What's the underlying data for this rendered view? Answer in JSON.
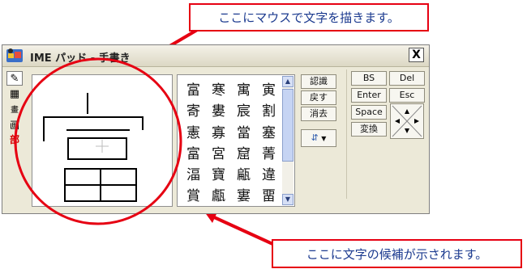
{
  "callouts": {
    "top": "ここにマウスで文字を描きます。",
    "bottom": "ここに文字の候補が示されます。"
  },
  "window": {
    "title": "IME パッド - 手書き",
    "close_label": "X"
  },
  "tools": [
    {
      "icon": "pen-icon",
      "glyph": "✎"
    },
    {
      "icon": "grid-icon",
      "glyph": "▦"
    },
    {
      "icon": "stroke-count-icon",
      "glyph": "画"
    },
    {
      "icon": "radical-icon",
      "glyph": "部"
    }
  ],
  "candidates": [
    "富",
    "寒",
    "寓",
    "寅",
    "寄",
    "婁",
    "宸",
    "割",
    "憲",
    "寡",
    "當",
    "塞",
    "富",
    "宮",
    "窟",
    "菁",
    "湢",
    "寶",
    "甂",
    "違",
    "賞",
    "甗",
    "寠",
    "畱"
  ],
  "actions": {
    "recognize": "認識",
    "back": "戻す",
    "clear": "消去",
    "bs": "BS",
    "del": "Del",
    "enter": "Enter",
    "esc": "Esc",
    "space": "Space",
    "convert": "変換"
  },
  "colors": {
    "accent_red": "#e60012",
    "callout_text": "#1b3a8f"
  }
}
